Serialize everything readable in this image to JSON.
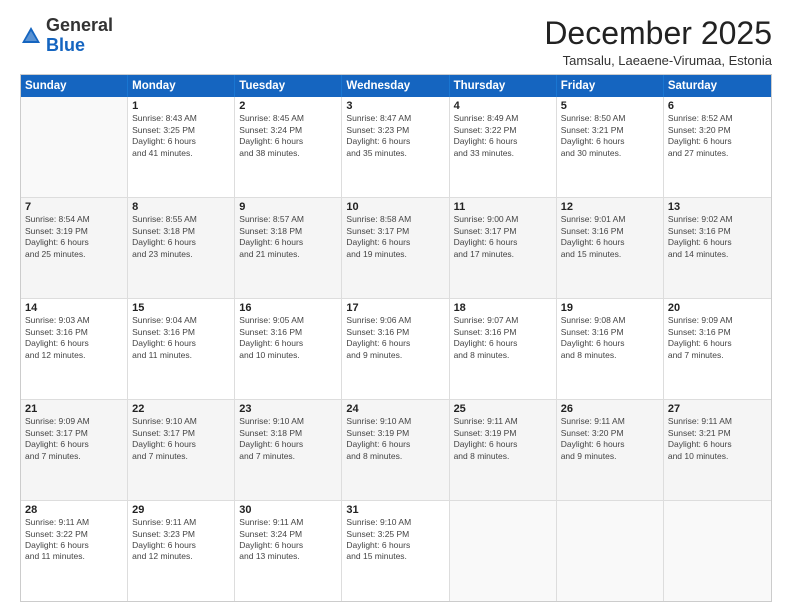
{
  "logo": {
    "general": "General",
    "blue": "Blue"
  },
  "header": {
    "month": "December 2025",
    "location": "Tamsalu, Laeaene-Virumaa, Estonia"
  },
  "days": [
    "Sunday",
    "Monday",
    "Tuesday",
    "Wednesday",
    "Thursday",
    "Friday",
    "Saturday"
  ],
  "weeks": [
    [
      {
        "date": "",
        "info": ""
      },
      {
        "date": "1",
        "info": "Sunrise: 8:43 AM\nSunset: 3:25 PM\nDaylight: 6 hours\nand 41 minutes."
      },
      {
        "date": "2",
        "info": "Sunrise: 8:45 AM\nSunset: 3:24 PM\nDaylight: 6 hours\nand 38 minutes."
      },
      {
        "date": "3",
        "info": "Sunrise: 8:47 AM\nSunset: 3:23 PM\nDaylight: 6 hours\nand 35 minutes."
      },
      {
        "date": "4",
        "info": "Sunrise: 8:49 AM\nSunset: 3:22 PM\nDaylight: 6 hours\nand 33 minutes."
      },
      {
        "date": "5",
        "info": "Sunrise: 8:50 AM\nSunset: 3:21 PM\nDaylight: 6 hours\nand 30 minutes."
      },
      {
        "date": "6",
        "info": "Sunrise: 8:52 AM\nSunset: 3:20 PM\nDaylight: 6 hours\nand 27 minutes."
      }
    ],
    [
      {
        "date": "7",
        "info": "Sunrise: 8:54 AM\nSunset: 3:19 PM\nDaylight: 6 hours\nand 25 minutes."
      },
      {
        "date": "8",
        "info": "Sunrise: 8:55 AM\nSunset: 3:18 PM\nDaylight: 6 hours\nand 23 minutes."
      },
      {
        "date": "9",
        "info": "Sunrise: 8:57 AM\nSunset: 3:18 PM\nDaylight: 6 hours\nand 21 minutes."
      },
      {
        "date": "10",
        "info": "Sunrise: 8:58 AM\nSunset: 3:17 PM\nDaylight: 6 hours\nand 19 minutes."
      },
      {
        "date": "11",
        "info": "Sunrise: 9:00 AM\nSunset: 3:17 PM\nDaylight: 6 hours\nand 17 minutes."
      },
      {
        "date": "12",
        "info": "Sunrise: 9:01 AM\nSunset: 3:16 PM\nDaylight: 6 hours\nand 15 minutes."
      },
      {
        "date": "13",
        "info": "Sunrise: 9:02 AM\nSunset: 3:16 PM\nDaylight: 6 hours\nand 14 minutes."
      }
    ],
    [
      {
        "date": "14",
        "info": "Sunrise: 9:03 AM\nSunset: 3:16 PM\nDaylight: 6 hours\nand 12 minutes."
      },
      {
        "date": "15",
        "info": "Sunrise: 9:04 AM\nSunset: 3:16 PM\nDaylight: 6 hours\nand 11 minutes."
      },
      {
        "date": "16",
        "info": "Sunrise: 9:05 AM\nSunset: 3:16 PM\nDaylight: 6 hours\nand 10 minutes."
      },
      {
        "date": "17",
        "info": "Sunrise: 9:06 AM\nSunset: 3:16 PM\nDaylight: 6 hours\nand 9 minutes."
      },
      {
        "date": "18",
        "info": "Sunrise: 9:07 AM\nSunset: 3:16 PM\nDaylight: 6 hours\nand 8 minutes."
      },
      {
        "date": "19",
        "info": "Sunrise: 9:08 AM\nSunset: 3:16 PM\nDaylight: 6 hours\nand 8 minutes."
      },
      {
        "date": "20",
        "info": "Sunrise: 9:09 AM\nSunset: 3:16 PM\nDaylight: 6 hours\nand 7 minutes."
      }
    ],
    [
      {
        "date": "21",
        "info": "Sunrise: 9:09 AM\nSunset: 3:17 PM\nDaylight: 6 hours\nand 7 minutes."
      },
      {
        "date": "22",
        "info": "Sunrise: 9:10 AM\nSunset: 3:17 PM\nDaylight: 6 hours\nand 7 minutes."
      },
      {
        "date": "23",
        "info": "Sunrise: 9:10 AM\nSunset: 3:18 PM\nDaylight: 6 hours\nand 7 minutes."
      },
      {
        "date": "24",
        "info": "Sunrise: 9:10 AM\nSunset: 3:19 PM\nDaylight: 6 hours\nand 8 minutes."
      },
      {
        "date": "25",
        "info": "Sunrise: 9:11 AM\nSunset: 3:19 PM\nDaylight: 6 hours\nand 8 minutes."
      },
      {
        "date": "26",
        "info": "Sunrise: 9:11 AM\nSunset: 3:20 PM\nDaylight: 6 hours\nand 9 minutes."
      },
      {
        "date": "27",
        "info": "Sunrise: 9:11 AM\nSunset: 3:21 PM\nDaylight: 6 hours\nand 10 minutes."
      }
    ],
    [
      {
        "date": "28",
        "info": "Sunrise: 9:11 AM\nSunset: 3:22 PM\nDaylight: 6 hours\nand 11 minutes."
      },
      {
        "date": "29",
        "info": "Sunrise: 9:11 AM\nSunset: 3:23 PM\nDaylight: 6 hours\nand 12 minutes."
      },
      {
        "date": "30",
        "info": "Sunrise: 9:11 AM\nSunset: 3:24 PM\nDaylight: 6 hours\nand 13 minutes."
      },
      {
        "date": "31",
        "info": "Sunrise: 9:10 AM\nSunset: 3:25 PM\nDaylight: 6 hours\nand 15 minutes."
      },
      {
        "date": "",
        "info": ""
      },
      {
        "date": "",
        "info": ""
      },
      {
        "date": "",
        "info": ""
      }
    ]
  ]
}
